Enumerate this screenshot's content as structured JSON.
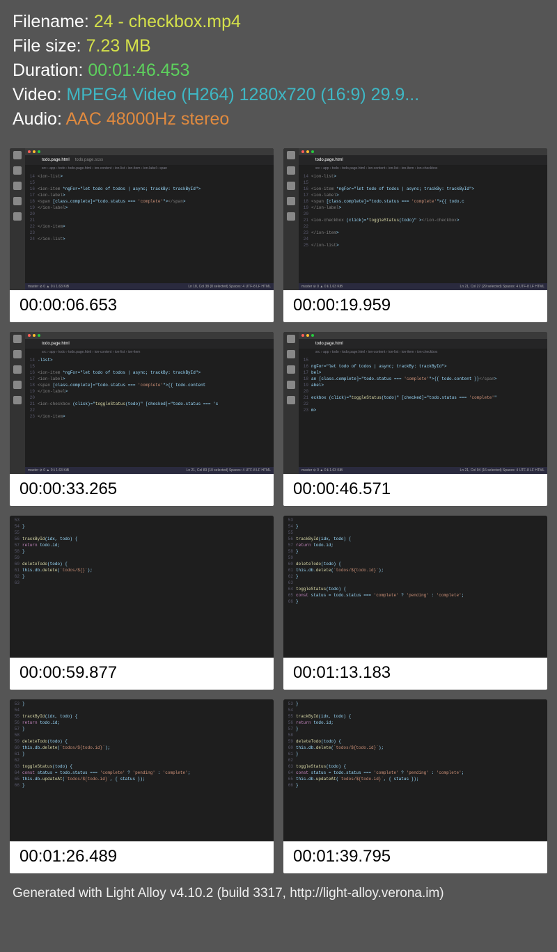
{
  "meta": {
    "filename_label": "Filename:",
    "filename_value": "24 - checkbox.mp4",
    "filesize_label": "File size:",
    "filesize_value": "7.23 MB",
    "duration_label": "Duration:",
    "duration_value": "00:01:46.453",
    "video_label": "Video:",
    "video_value": "MPEG4 Video (H264) 1280x720 (16:9) 29.9...",
    "audio_label": "Audio:",
    "audio_value": "AAC 48000Hz stereo"
  },
  "thumbnails": [
    {
      "timestamp": "00:00:06.653",
      "tab": "todo.page.html",
      "tab2": "todo.page.scss",
      "breadcrumb": "src › app › todo › todo.page.html › ion-content › ion-list › ion-item › ion-label › span",
      "lines": [
        {
          "n": "14",
          "t": "<ion-list>"
        },
        {
          "n": "15",
          "t": ""
        },
        {
          "n": "16",
          "t": "  <ion-item *ngFor=\"let todo of todos | async; trackBy: trackById\">"
        },
        {
          "n": "17",
          "t": "    <ion-label>"
        },
        {
          "n": "18",
          "t": "      <span [class.complete]=\"todo.status === 'complete'\"></span>"
        },
        {
          "n": "19",
          "t": "    </ion-label>"
        },
        {
          "n": "20",
          "t": ""
        },
        {
          "n": "21",
          "t": ""
        },
        {
          "n": "22",
          "t": "  </ion-item>"
        },
        {
          "n": "23",
          "t": ""
        },
        {
          "n": "24",
          "t": "</ion-list>"
        }
      ],
      "status_left": "master  ⊘ 0 ▲ 0 ℹ 1.63 KiB",
      "status_right": "Ln 18, Col 38 (8 selected)   Spaces: 4   UTF-8   LF   HTML"
    },
    {
      "timestamp": "00:00:19.959",
      "tab": "todo.page.html",
      "breadcrumb": "src › app › todo › todo.page.html › ion-content › ion-list › ion-item › ion-checkbox",
      "lines": [
        {
          "n": "14",
          "t": "<ion-list>"
        },
        {
          "n": "15",
          "t": ""
        },
        {
          "n": "16",
          "t": "  <ion-item *ngFor=\"let todo of todos | async; trackBy: trackById\">"
        },
        {
          "n": "17",
          "t": "    <ion-label>"
        },
        {
          "n": "18",
          "t": "      <span [class.complete]=\"todo.status === 'complete'\">{{ todo.c"
        },
        {
          "n": "19",
          "t": "    </ion-label>"
        },
        {
          "n": "20",
          "t": ""
        },
        {
          "n": "21",
          "t": "    <ion-checkbox (click)=\"toggleStatus(todo)\" ></ion-checkbox>"
        },
        {
          "n": "22",
          "t": ""
        },
        {
          "n": "23",
          "t": "  </ion-item>"
        },
        {
          "n": "24",
          "t": ""
        },
        {
          "n": "25",
          "t": "</ion-list>"
        }
      ],
      "status_left": "master  ⊘ 0 ▲ 0 ℹ 1.63 KiB",
      "status_right": "Ln 21, Col 27 (29 selected)   Spaces: 4   UTF-8   LF   HTML"
    },
    {
      "timestamp": "00:00:33.265",
      "tab": "todo.page.html",
      "breadcrumb": "src › app › todo › todo.page.html › ion-content › ion-list › ion-item",
      "lines": [
        {
          "n": "14",
          "t": "-list>"
        },
        {
          "n": "15",
          "t": ""
        },
        {
          "n": "16",
          "t": "<ion-item *ngFor=\"let todo of todos | async; trackBy: trackById\">"
        },
        {
          "n": "17",
          "t": "  <ion-label>"
        },
        {
          "n": "18",
          "t": "    <span [class.complete]=\"todo.status === 'complete'\">{{ todo.content"
        },
        {
          "n": "19",
          "t": "  </ion-label>"
        },
        {
          "n": "20",
          "t": ""
        },
        {
          "n": "21",
          "t": "  <ion-checkbox (click)=\"toggleStatus(todo)\" [checked]=\"todo.status === 'c"
        },
        {
          "n": "22",
          "t": ""
        },
        {
          "n": "23",
          "t": "</ion-item>"
        }
      ],
      "status_left": "master  ⊘ 0 ▲ 0 ℹ 1.63 KiB",
      "status_right": "Ln 21, Col 83 (10 selected)   Spaces: 4   UTF-8   LF   HTML"
    },
    {
      "timestamp": "00:00:46.571",
      "tab": "todo.page.html",
      "breadcrumb": "src › app › todo › todo.page.html › ion-content › ion-list › ion-item › ion-checkbox",
      "lines": [
        {
          "n": "15",
          "t": ""
        },
        {
          "n": "16",
          "t": "ngFor=\"let todo of todos | async; trackBy: trackById\">"
        },
        {
          "n": "17",
          "t": "bel>"
        },
        {
          "n": "18",
          "t": "an [class.complete]=\"todo.status === 'complete'\">{{ todo.content }}</span>"
        },
        {
          "n": "19",
          "t": "abel>"
        },
        {
          "n": "20",
          "t": ""
        },
        {
          "n": "21",
          "t": "eckbox (click)=\"toggleStatus(todo)\" [checked]=\"todo.status === 'complete'\""
        },
        {
          "n": "22",
          "t": ""
        },
        {
          "n": "23",
          "t": "m>"
        }
      ],
      "status_left": "master  ⊘ 0 ▲ 0 ℹ 1.63 KiB",
      "status_right": "Ln 21, Col 94 (16 selected)   Spaces: 4   UTF-8   LF   HTML"
    },
    {
      "timestamp": "00:00:59.877",
      "lines": [
        {
          "n": "53",
          "t": ""
        },
        {
          "n": "54",
          "t": "}"
        },
        {
          "n": "55",
          "t": ""
        },
        {
          "n": "56",
          "t": "trackById(idx, todo) {"
        },
        {
          "n": "57",
          "t": "  return todo.id;"
        },
        {
          "n": "58",
          "t": "}"
        },
        {
          "n": "59",
          "t": ""
        },
        {
          "n": "60",
          "t": "deleteTodo(todo) {"
        },
        {
          "n": "61",
          "t": "  this.db.delete(`todos/${}`);"
        },
        {
          "n": "62",
          "t": "}"
        },
        {
          "n": "63",
          "t": ""
        }
      ]
    },
    {
      "timestamp": "00:01:13.183",
      "lines": [
        {
          "n": "53",
          "t": ""
        },
        {
          "n": "54",
          "t": "}"
        },
        {
          "n": "55",
          "t": ""
        },
        {
          "n": "56",
          "t": "trackById(idx, todo) {"
        },
        {
          "n": "57",
          "t": "  return todo.id;"
        },
        {
          "n": "58",
          "t": "}"
        },
        {
          "n": "59",
          "t": ""
        },
        {
          "n": "60",
          "t": "deleteTodo(todo) {"
        },
        {
          "n": "61",
          "t": "  this.db.delete(`todos/${todo.id}`);"
        },
        {
          "n": "62",
          "t": "}"
        },
        {
          "n": "63",
          "t": ""
        },
        {
          "n": "64",
          "t": "toggleStatus(todo) {"
        },
        {
          "n": "65",
          "t": "  const status = todo.status === 'complete' ? 'pending' : 'complete';"
        },
        {
          "n": "66",
          "t": "}"
        }
      ]
    },
    {
      "timestamp": "00:01:26.489",
      "lines": [
        {
          "n": "53",
          "t": "}"
        },
        {
          "n": "54",
          "t": ""
        },
        {
          "n": "55",
          "t": "trackById(idx, todo) {"
        },
        {
          "n": "56",
          "t": "  return todo.id;"
        },
        {
          "n": "57",
          "t": "}"
        },
        {
          "n": "58",
          "t": ""
        },
        {
          "n": "59",
          "t": "deleteTodo(todo) {"
        },
        {
          "n": "60",
          "t": "  this.db.delete(`todos/${todo.id}`);"
        },
        {
          "n": "61",
          "t": "}"
        },
        {
          "n": "62",
          "t": ""
        },
        {
          "n": "63",
          "t": "toggleStatus(todo) {"
        },
        {
          "n": "64",
          "t": "  const status = todo.status === 'complete' ? 'pending' : 'complete';"
        },
        {
          "n": "65",
          "t": "  this.db.updateAt(`todos/${todo.id}`, { status });"
        },
        {
          "n": "66",
          "t": "}"
        }
      ]
    },
    {
      "timestamp": "00:01:39.795",
      "lines": [
        {
          "n": "53",
          "t": "}"
        },
        {
          "n": "54",
          "t": ""
        },
        {
          "n": "55",
          "t": "trackById(idx, todo) {"
        },
        {
          "n": "56",
          "t": "  return todo.id;"
        },
        {
          "n": "57",
          "t": "}"
        },
        {
          "n": "58",
          "t": ""
        },
        {
          "n": "59",
          "t": "deleteTodo(todo) {"
        },
        {
          "n": "60",
          "t": "  this.db.delete(`todos/${todo.id}`);"
        },
        {
          "n": "61",
          "t": "}"
        },
        {
          "n": "62",
          "t": ""
        },
        {
          "n": "63",
          "t": "toggleStatus(todo) {"
        },
        {
          "n": "64",
          "t": "  const status = todo.status === 'complete' ? 'pending' : 'complete';"
        },
        {
          "n": "65",
          "t": "  this.db.updateAt(`todos/${todo.id}`, { status });"
        },
        {
          "n": "66",
          "t": "}"
        }
      ]
    }
  ],
  "footer": "Generated with Light Alloy v4.10.2 (build 3317, http://light-alloy.verona.im)"
}
